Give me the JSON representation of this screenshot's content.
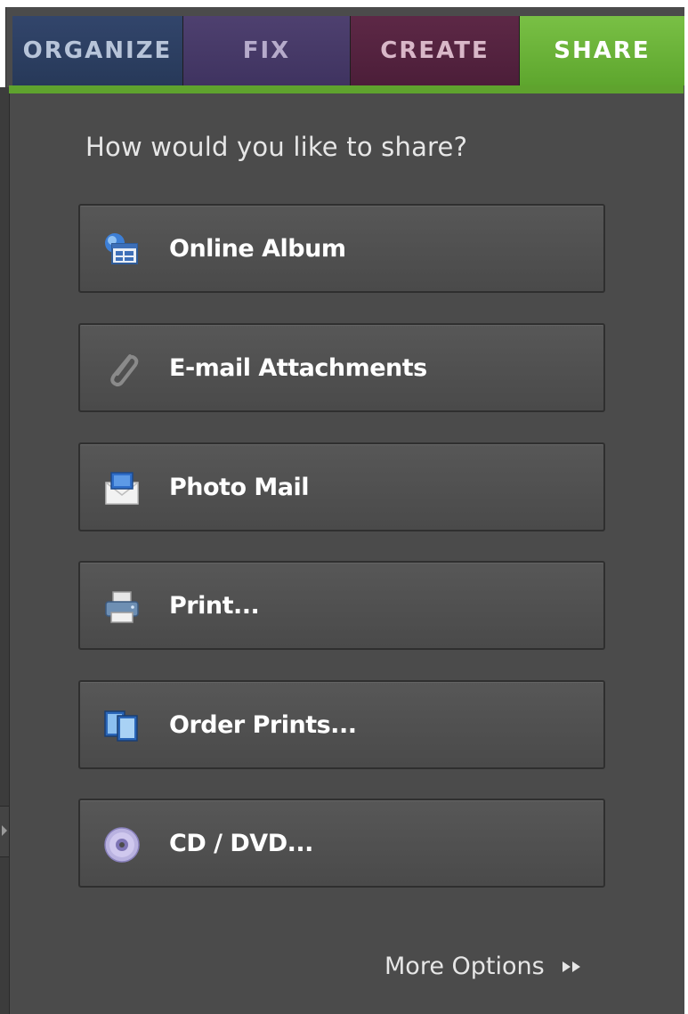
{
  "tabs": [
    {
      "label": "ORGANIZE",
      "active": false
    },
    {
      "label": "FIX",
      "active": false
    },
    {
      "label": "CREATE",
      "active": false
    },
    {
      "label": "SHARE",
      "active": true
    }
  ],
  "share_panel": {
    "prompt": "How would you like to share?",
    "options": [
      {
        "label": "Online Album",
        "icon": "online-album-icon"
      },
      {
        "label": "E-mail Attachments",
        "icon": "paperclip-icon"
      },
      {
        "label": "Photo Mail",
        "icon": "photo-mail-icon"
      },
      {
        "label": "Print...",
        "icon": "printer-icon"
      },
      {
        "label": "Order Prints...",
        "icon": "order-prints-icon"
      },
      {
        "label": "CD / DVD...",
        "icon": "disc-icon"
      }
    ],
    "more_options_label": "More Options"
  },
  "colors": {
    "panel_bg": "#4b4b4b",
    "share_accent": "#6ab235",
    "organize_tab": "#2d4063",
    "fix_tab": "#473a68",
    "create_tab": "#552341"
  }
}
